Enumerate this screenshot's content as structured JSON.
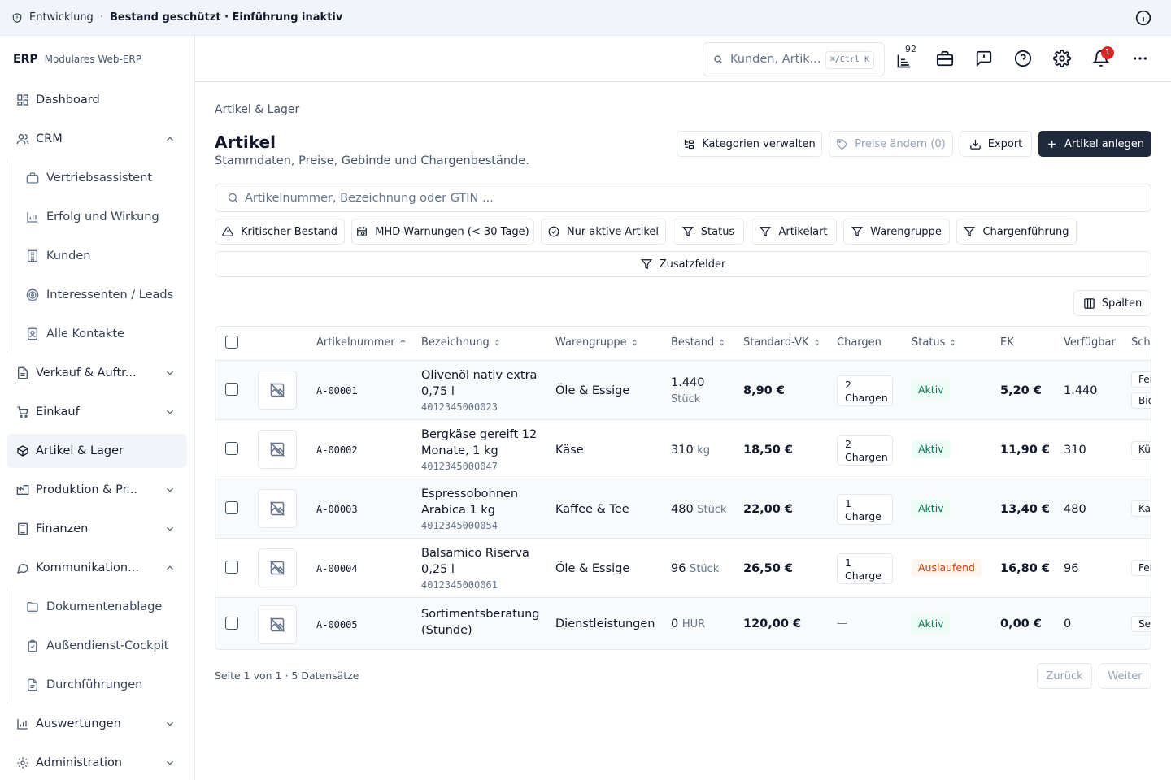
{
  "banner": {
    "environment": "Entwicklung",
    "separator": "·",
    "state": "Bestand geschützt · Einführung inaktiv"
  },
  "brand": {
    "logo": "ERP",
    "subtitle": "Modulares Web-ERP"
  },
  "sidebar": {
    "dashboard": "Dashboard",
    "crm": "CRM",
    "crm_items": [
      "Vertriebsassistent",
      "Erfolg und Wirkung",
      "Kunden",
      "Interessenten / Leads",
      "Alle Kontakte"
    ],
    "sales": "Verkauf & Auftr...",
    "purchasing": "Einkauf",
    "articles": "Artikel & Lager",
    "production": "Produktion & Pr...",
    "finance": "Finanzen",
    "communication": "Kommunikation...",
    "communication_items": [
      "Dokumentenablage",
      "Außendienst-Cockpit",
      "Durchführungen"
    ],
    "reports": "Auswertungen",
    "admin": "Administration"
  },
  "topbar": {
    "search_placeholder": "Kunden, Artik...",
    "shortcut": "⌘/Ctrl K",
    "queue_count": "92",
    "notification_count": "1"
  },
  "page": {
    "breadcrumb": "Artikel & Lager",
    "title": "Artikel",
    "subtitle": "Stammdaten, Preise, Gebinde und Chargenbestände.",
    "actions": {
      "categories": "Kategorien verwalten",
      "prices": "Preise ändern (0)",
      "export": "Export",
      "create": "Artikel anlegen"
    },
    "search_placeholder": "Artikelnummer, Bezeichnung oder GTIN ...",
    "filters": {
      "critical": "Kritischer Bestand",
      "mhd": "MHD-Warnungen (< 30 Tage)",
      "active_only": "Nur aktive Artikel",
      "status": "Status",
      "type": "Artikelart",
      "group": "Warengruppe",
      "batch": "Chargenführung",
      "extra": "Zusatzfelder"
    },
    "columns_button": "Spalten"
  },
  "table": {
    "headers": {
      "number": "Artikelnummer",
      "name": "Bezeichnung",
      "group": "Warengruppe",
      "stock": "Bestand",
      "price": "Standard-VK",
      "batches": "Chargen",
      "status": "Status",
      "ek": "EK",
      "available": "Verfügbar",
      "keywords": "Schl"
    },
    "rows": [
      {
        "number": "A-00001",
        "name1": "Olivenöl nativ extra",
        "name2": "0,75 l",
        "gtin": "4012345000023",
        "group": "Öle & Essige",
        "stock": "1.440",
        "unit": "Stück",
        "price": "8,90 €",
        "batch1": "2",
        "batch2": "Chargen",
        "status": "Aktiv",
        "ek": "5,20 €",
        "available": "1.440",
        "tag1": "Feinkost",
        "tag2": "Bio"
      },
      {
        "number": "A-00002",
        "name1": "Bergkäse gereift 12",
        "name2": "Monate, 1 kg",
        "gtin": "4012345000047",
        "group": "Käse",
        "stock": "310",
        "unit": "kg",
        "price": "18,50 €",
        "batch1": "2",
        "batch2": "Chargen",
        "status": "Aktiv",
        "ek": "11,90 €",
        "available": "310",
        "tag1": "Kühlware"
      },
      {
        "number": "A-00003",
        "name1": "Espressobohnen",
        "name2": "Arabica 1 kg",
        "gtin": "4012345000054",
        "group": "Kaffee & Tee",
        "stock": "480",
        "unit": "Stück",
        "price": "22,00 €",
        "batch1": "1",
        "batch2": "Charge",
        "status": "Aktiv",
        "ek": "13,40 €",
        "available": "480",
        "tag1": "Kaffee"
      },
      {
        "number": "A-00004",
        "name1": "Balsamico Riserva",
        "name2": "0,25 l",
        "gtin": "4012345000061",
        "group": "Öle & Essige",
        "stock": "96",
        "unit": "Stück",
        "price": "26,50 €",
        "batch1": "1",
        "batch2": "Charge",
        "status": "Auslaufend",
        "ek": "16,80 €",
        "available": "96",
        "tag1": "Feinkost"
      },
      {
        "number": "A-00005",
        "name1": "Sortimentsberatung",
        "name2": "(Stunde)",
        "group": "Dienstleistungen",
        "stock": "0",
        "unit": "HUR",
        "price": "120,00 €",
        "batch_empty": "—",
        "status": "Aktiv",
        "ek": "0,00 €",
        "available": "0",
        "tag1": "Service"
      }
    ]
  },
  "pagination": {
    "info": "Seite 1 von 1 · 5 Datensätze",
    "prev": "Zurück",
    "next": "Weiter"
  }
}
